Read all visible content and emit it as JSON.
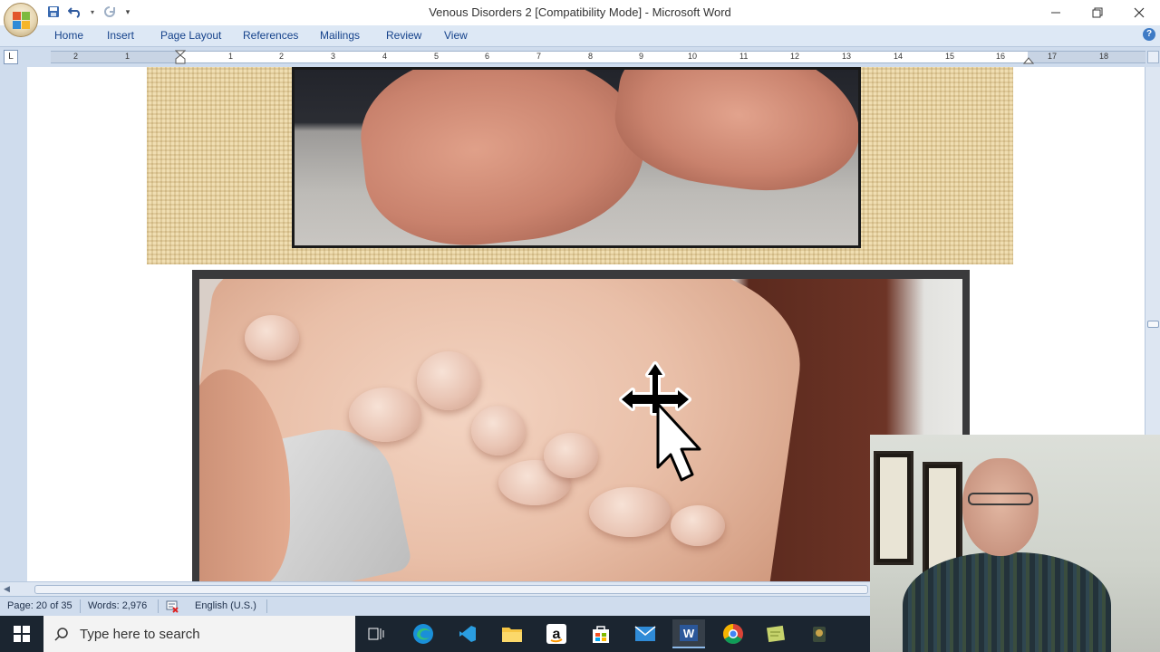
{
  "window": {
    "title": "Venous Disorders 2 [Compatibility Mode] - Microsoft Word",
    "minimize_glyph": "—",
    "close_glyph": "✕"
  },
  "ribbon": {
    "tabs": [
      "Home",
      "Insert",
      "Page Layout",
      "References",
      "Mailings",
      "Review",
      "View"
    ],
    "help_glyph": "?"
  },
  "ruler": {
    "corner_glyph": "L",
    "left_numbers": [
      "2",
      "1"
    ],
    "right_numbers": [
      "1",
      "2",
      "3",
      "4",
      "5",
      "6",
      "7",
      "8",
      "9",
      "10",
      "11",
      "12",
      "13",
      "14",
      "15",
      "16",
      "17",
      "18"
    ]
  },
  "statusbar": {
    "page": "Page: 20 of 35",
    "words": "Words: 2,976",
    "language": "English (U.S.)"
  },
  "taskbar": {
    "search_placeholder": "Type here to search",
    "apps": [
      "task-view",
      "edge",
      "vs-code",
      "file-explorer",
      "amazon",
      "store",
      "mail",
      "word",
      "chrome",
      "notes",
      "game"
    ]
  },
  "icons": {
    "office": "office-logo-icon",
    "save": "save-icon",
    "undo": "undo-icon",
    "redo": "redo-icon",
    "move_cursor": "move-cursor-icon"
  },
  "colors": {
    "ribbon_text": "#15428b",
    "word_blue": "#2b579a",
    "taskbar": "#1b2530"
  }
}
